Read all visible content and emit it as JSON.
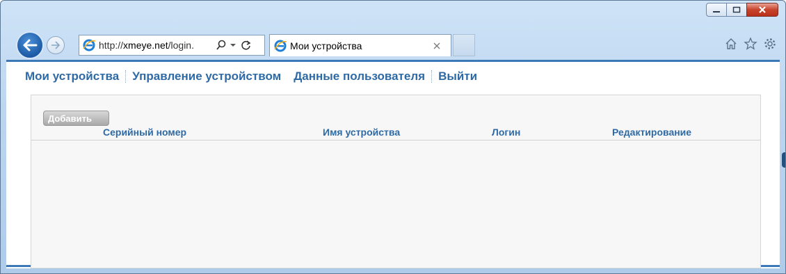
{
  "browser": {
    "url_host": "http://",
    "url_domain": "xmeye.net",
    "url_path": "/login.",
    "tab_title": "Мои устройства"
  },
  "nav": {
    "items": [
      "Мои устройства",
      "Управление устройством",
      "Данные пользователя",
      "Выйти"
    ]
  },
  "panel": {
    "add_button": "Добавить",
    "columns": [
      "Серийный номер",
      "Имя устройства",
      "Логин",
      "Редактирование"
    ]
  },
  "icons": {
    "back": "back-arrow-icon",
    "forward": "forward-arrow-icon",
    "ie": "internet-explorer-icon",
    "search": "search-icon",
    "refresh": "refresh-icon",
    "home": "home-icon",
    "favorites": "star-icon",
    "settings": "gear-icon"
  },
  "colors": {
    "accent": "#2e6aa6",
    "frame": "#3a78b8"
  }
}
